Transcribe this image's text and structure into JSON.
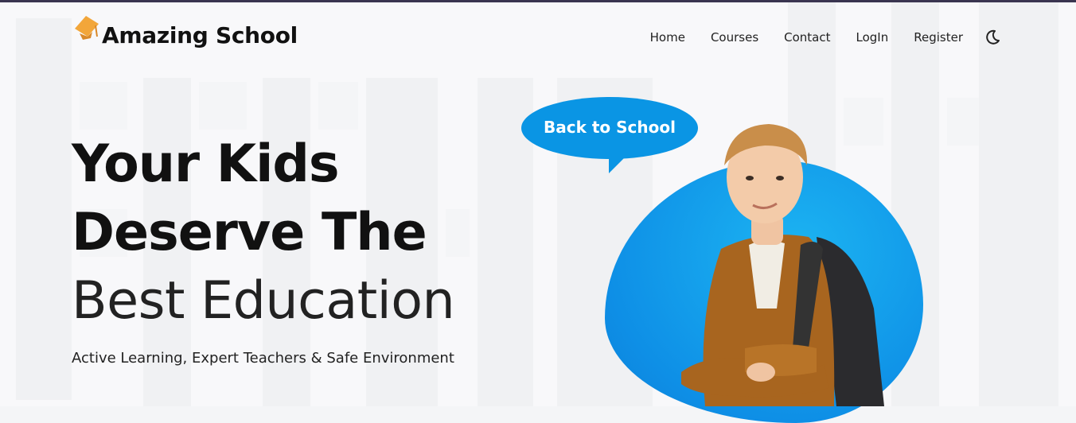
{
  "brand": {
    "name": "Amazing School",
    "icon": "graduation-cap-icon",
    "icon_color": "#f2a63a"
  },
  "nav": {
    "items": [
      {
        "label": "Home"
      },
      {
        "label": "Courses"
      },
      {
        "label": "Contact"
      },
      {
        "label": "LogIn"
      },
      {
        "label": "Register"
      }
    ],
    "theme_toggle_icon": "moon-icon"
  },
  "hero": {
    "title_line1": "Your Kids",
    "title_line2": "Deserve The",
    "title_line3": "Best Education",
    "tagline": "Active Learning, Expert Teachers & Safe Environment",
    "bubble_text": "Back to School",
    "accent_color": "#0a95e4",
    "image": "student-with-backpack"
  }
}
